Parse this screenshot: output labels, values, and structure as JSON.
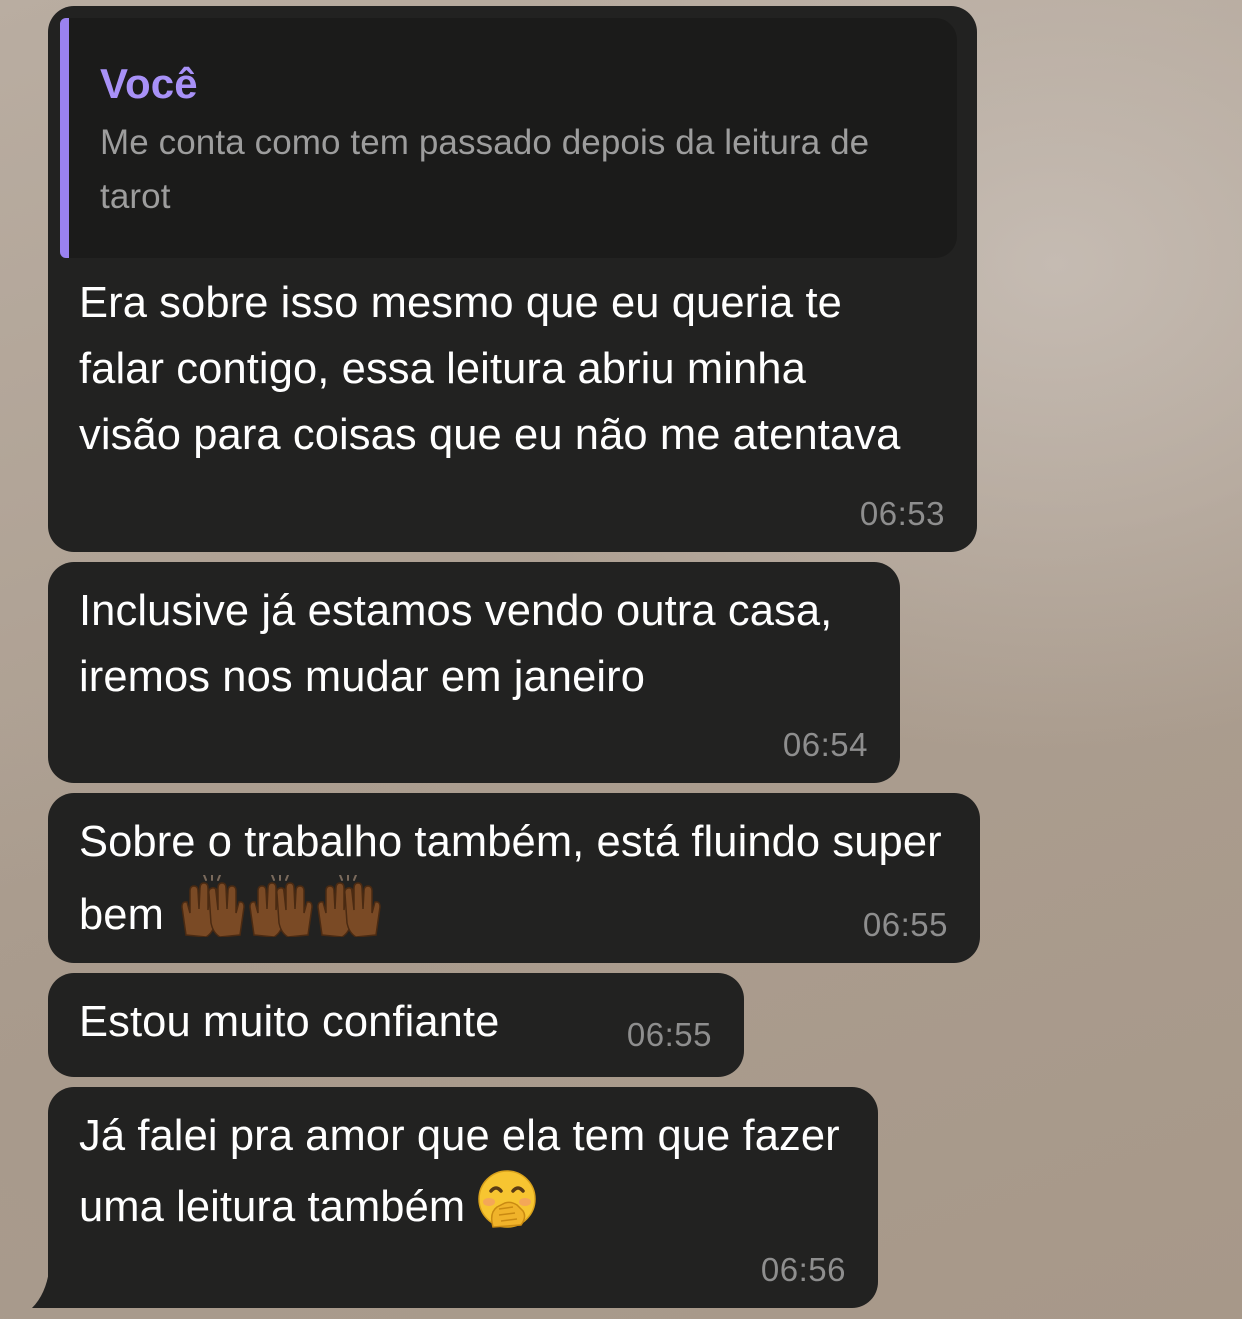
{
  "messages": [
    {
      "reply": {
        "author": "Você",
        "text": "Me conta como tem passado depois da leitura de tarot"
      },
      "text": "Era sobre isso mesmo que eu queria te falar contigo, essa leitura abriu minha visão para coisas que eu não me atentava",
      "time": "06:53"
    },
    {
      "text": "Inclusive já estamos vendo outra casa, iremos nos mudar em janeiro",
      "time": "06:54"
    },
    {
      "text": "Sobre o trabalho também, está fluindo super bem",
      "emoji": "raising-hands-dark-skin-tone x3",
      "time": "06:55"
    },
    {
      "text": "Estou muito confiante",
      "time": "06:55"
    },
    {
      "text": "Já falei pra amor que ela tem que fazer uma leitura também",
      "emoji": "face-with-hand-over-mouth",
      "time": "06:56"
    }
  ],
  "colors": {
    "bubble": "#222221",
    "reply_accent": "#9a82f0",
    "timestamp": "#8e8e8e",
    "wallpaper": "#b2a497"
  }
}
